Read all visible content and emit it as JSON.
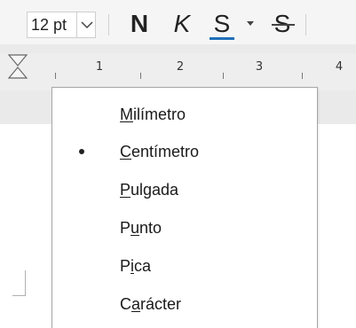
{
  "toolbar": {
    "font_size": "12 pt",
    "bold_label": "N",
    "italic_label": "K",
    "underline_label": "S",
    "strikethrough_label": "S"
  },
  "ruler": {
    "numbers": [
      "1",
      "2",
      "3",
      "4"
    ]
  },
  "menu": {
    "items": [
      {
        "pre": "",
        "mn": "M",
        "post": "ilímetro",
        "checked": false
      },
      {
        "pre": "",
        "mn": "C",
        "post": "entímetro",
        "checked": true
      },
      {
        "pre": "",
        "mn": "P",
        "post": "ulgada",
        "checked": false
      },
      {
        "pre": "P",
        "mn": "u",
        "post": "nto",
        "checked": false
      },
      {
        "pre": "P",
        "mn": "i",
        "post": "ca",
        "checked": false
      },
      {
        "pre": "C",
        "mn": "a",
        "post": "rácter",
        "checked": false
      }
    ]
  },
  "icons": {
    "dropdown": "chevron-down-icon",
    "indent": "indent-marker-icon",
    "underline_options": "triangle-down-icon"
  },
  "colors": {
    "underline_accent": "#1f6fb9"
  }
}
